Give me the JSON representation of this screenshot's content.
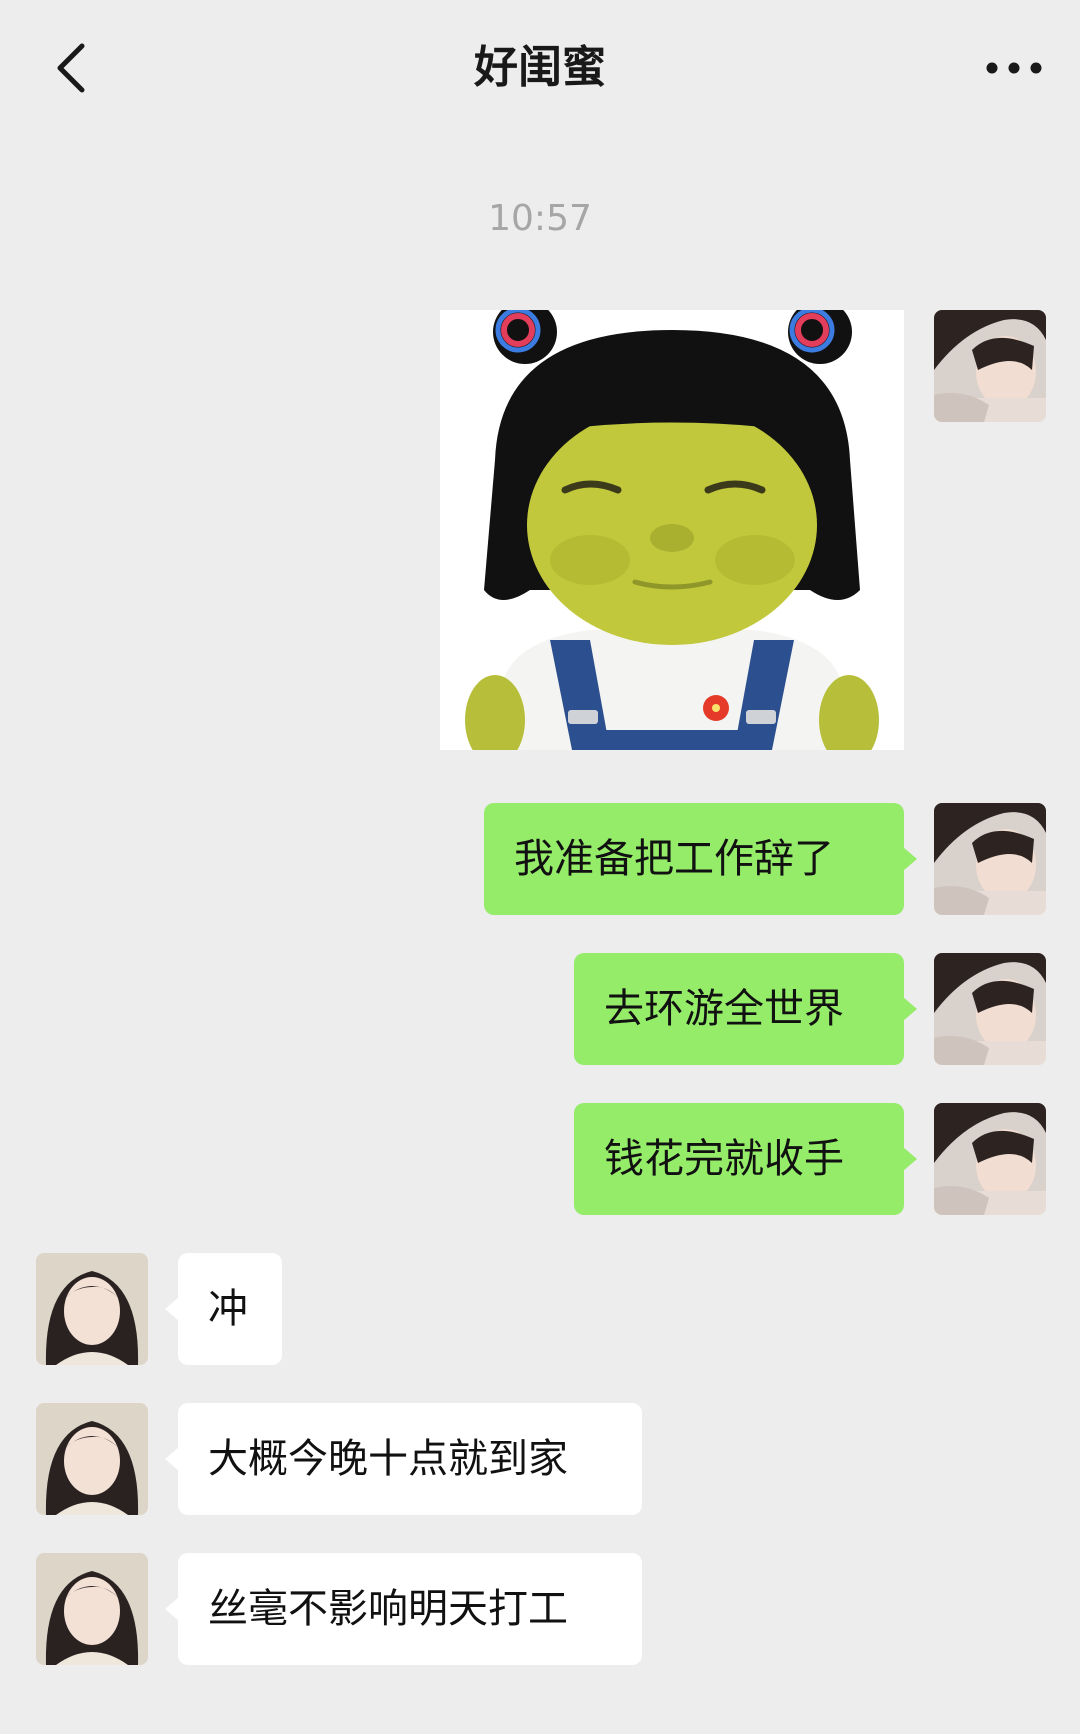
{
  "header": {
    "title": "好闺蜜",
    "back_icon": "chevron-left-icon",
    "more_icon": "more-dots-icon"
  },
  "timestamp": "10:57",
  "sent_messages": [
    {
      "text": "我准备把工作辞了"
    },
    {
      "text": "去环游全世界"
    },
    {
      "text": "钱花完就收手"
    }
  ],
  "received_messages": [
    {
      "text": "冲"
    },
    {
      "text": "大概今晚十点就到家"
    },
    {
      "text": "丝毫不影响明天打工"
    }
  ],
  "colors": {
    "background": "#ededed",
    "sent_bubble": "#95ec69",
    "received_bubble": "#ffffff",
    "timestamp": "#a6a6a6"
  }
}
